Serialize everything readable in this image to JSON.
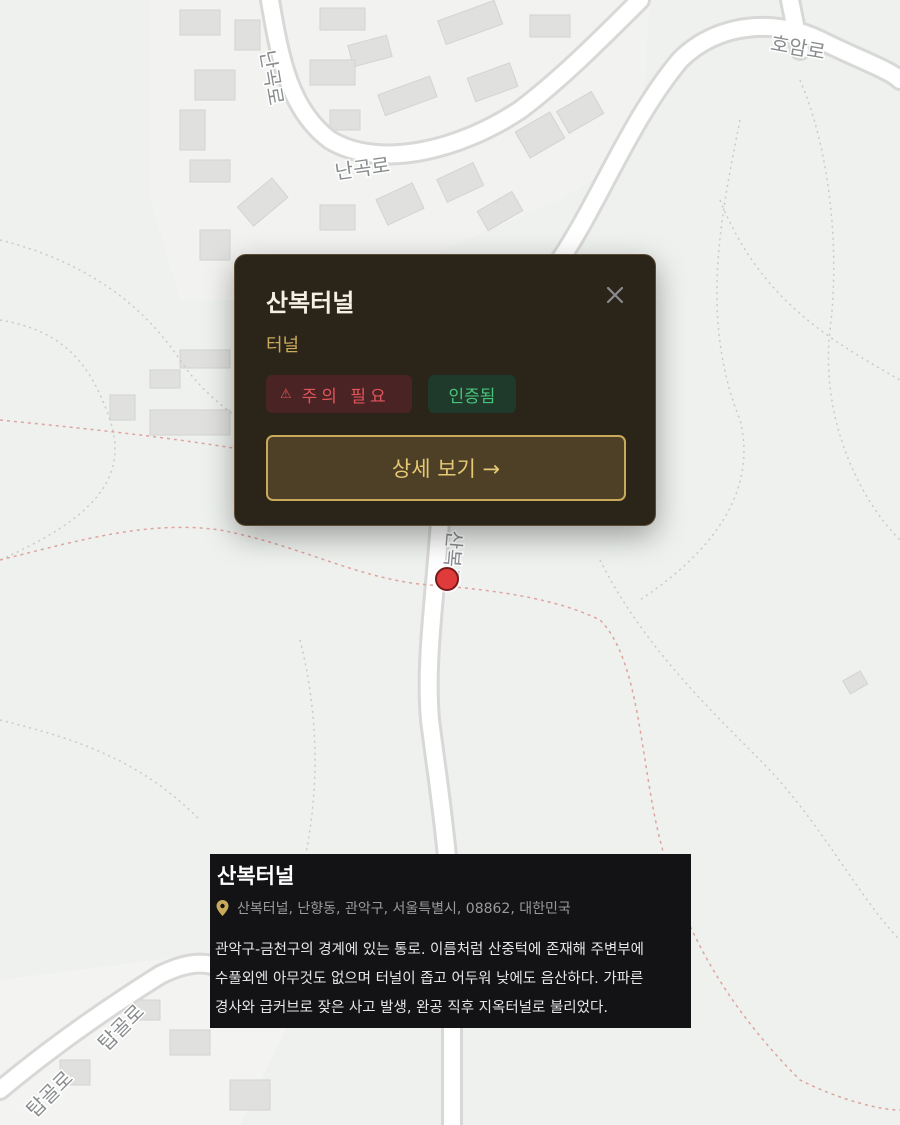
{
  "map": {
    "road_labels": [
      "난곡로",
      "난곡로",
      "호암로",
      "산복로",
      "탑골로",
      "탑골로"
    ]
  },
  "popup": {
    "title": "산복터널",
    "category": "터널",
    "badges": {
      "warning_icon": "warning-triangle-icon",
      "warning": "주의 필요",
      "verified": "인증됨"
    },
    "detail_button": "상세 보기 →",
    "close_icon": "close-icon"
  },
  "info_card": {
    "title": "산복터널",
    "address_icon": "location-pin-icon",
    "address": "산복터널, 난향동, 관악구, 서울특별시, 08862, 대한민국",
    "description": "관악구-금천구의 경계에 있는 통로. 이름처럼 산중턱에 존재해 주변부에\n수풀외엔 아무것도 없으며 터널이 좁고 어두워 낮에도 음산하다. 가파른\n경사와 급커브로 잦은 사고 발생, 완공 직후 지옥터널로 불리었다."
  },
  "colors": {
    "popup_bg": "#2a2419",
    "accent_gold": "#c9a95a",
    "warning_red": "#e0555b",
    "verified_green": "#49c27a",
    "marker_red": "#e03b3b"
  }
}
